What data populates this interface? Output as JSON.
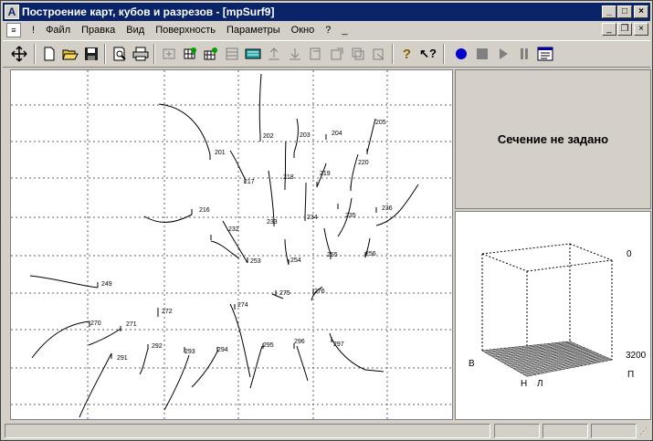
{
  "window": {
    "title": "Построение карт, кубов и разрезов - [mpSurf9]"
  },
  "menu": {
    "items": [
      {
        "label": "!"
      },
      {
        "label": "Файл"
      },
      {
        "label": "Правка"
      },
      {
        "label": "Вид"
      },
      {
        "label": "Поверхность"
      },
      {
        "label": "Параметры"
      },
      {
        "label": "Окно"
      },
      {
        "label": "?"
      },
      {
        "label": "_"
      }
    ]
  },
  "section": {
    "status_text": "Сечение не задано"
  },
  "cube": {
    "label_top": "0",
    "label_depth": "3200",
    "label_west": "В",
    "label_east": "П",
    "label_north": "Н",
    "label_left": "Л"
  },
  "wells": [
    {
      "id": "201"
    },
    {
      "id": "202"
    },
    {
      "id": "203"
    },
    {
      "id": "204"
    },
    {
      "id": "205"
    },
    {
      "id": "216"
    },
    {
      "id": "217"
    },
    {
      "id": "218"
    },
    {
      "id": "219"
    },
    {
      "id": "220"
    },
    {
      "id": "232"
    },
    {
      "id": "233"
    },
    {
      "id": "234"
    },
    {
      "id": "235"
    },
    {
      "id": "236"
    },
    {
      "id": "249"
    },
    {
      "id": "253"
    },
    {
      "id": "254"
    },
    {
      "id": "255"
    },
    {
      "id": "256"
    },
    {
      "id": "270"
    },
    {
      "id": "271"
    },
    {
      "id": "272"
    },
    {
      "id": "274"
    },
    {
      "id": "275"
    },
    {
      "id": "276"
    },
    {
      "id": "291"
    },
    {
      "id": "292"
    },
    {
      "id": "293"
    },
    {
      "id": "294"
    },
    {
      "id": "295"
    },
    {
      "id": "296"
    },
    {
      "id": "297"
    }
  ],
  "icons": {
    "move": "move-icon",
    "new": "new-doc-icon",
    "open": "open-folder-icon",
    "save": "save-icon",
    "preview": "print-preview-icon",
    "print": "print-icon",
    "help": "help-icon",
    "context_help": "context-help-icon",
    "record": "record-icon",
    "stop": "stop-icon",
    "play": "play-icon",
    "pause": "pause-icon",
    "script": "script-icon"
  },
  "colors": {
    "titlebar": "#0a246a",
    "record": "#0000cc",
    "face": "#d4d0c8"
  }
}
